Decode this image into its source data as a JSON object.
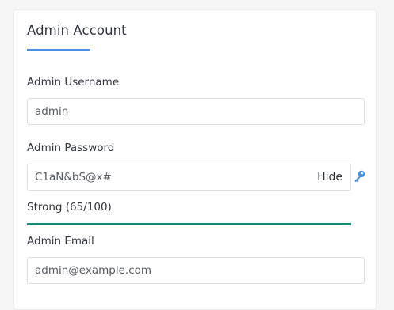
{
  "section": {
    "title": "Admin Account"
  },
  "username": {
    "label": "Admin Username",
    "value": "admin"
  },
  "password": {
    "label": "Admin Password",
    "value": "C1aN&bS@x#",
    "toggle_label": "Hide",
    "strength_text": "Strong (65/100)",
    "strength_score": 65,
    "strength_max": 100,
    "strength_color": "#138a72"
  },
  "email": {
    "label": "Admin Email",
    "value": "admin@example.com"
  },
  "colors": {
    "accent": "#4a90e2",
    "key_icon": "#4a90e2"
  },
  "icons": {
    "password_generator": "key-icon"
  }
}
